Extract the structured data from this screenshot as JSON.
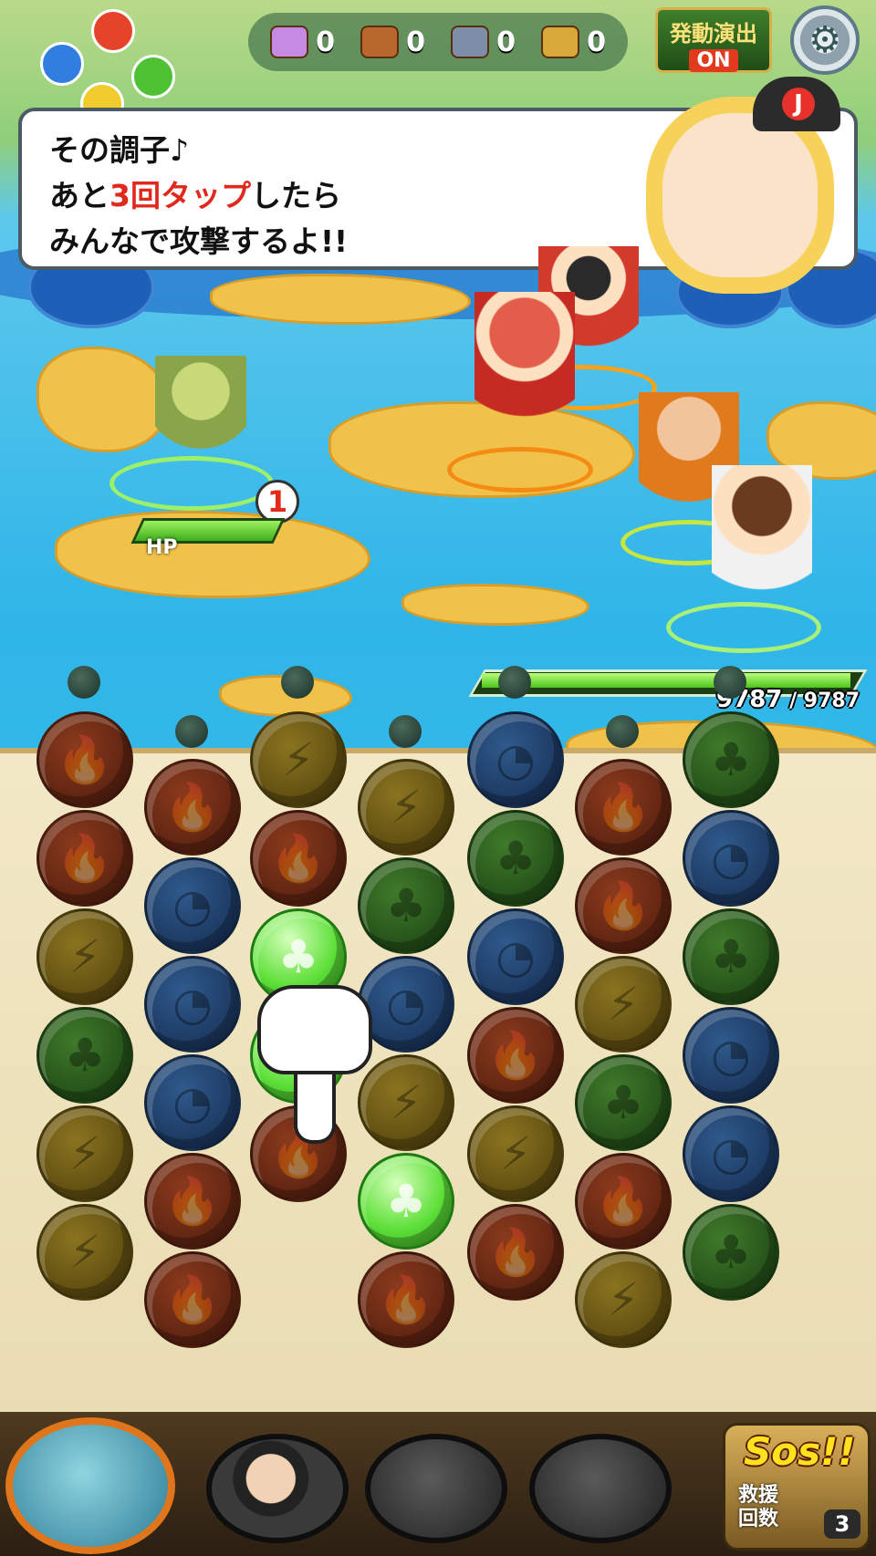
{
  "hud": {
    "chests": [
      {
        "icon": "rainbow-chest-icon",
        "count": "0",
        "color": "#c58be3"
      },
      {
        "icon": "bronze-chest-icon",
        "count": "0",
        "color": "#b8682d"
      },
      {
        "icon": "silver-chest-icon",
        "count": "0",
        "color": "#7f8ea8"
      },
      {
        "icon": "gold-chest-icon",
        "count": "0",
        "color": "#d9a83a"
      }
    ],
    "effect_button": {
      "line1": "発動演出",
      "line2": "ON"
    },
    "settings_icon": "gear-icon"
  },
  "dialog": {
    "line1": "その調子♪",
    "line2_pre": "あと",
    "line2_red": "3回タップ",
    "line2_post": "したら",
    "line3": "みんなで攻撃するよ!!"
  },
  "enemy": {
    "turn_count": "1",
    "hp_label": "HP",
    "hp_fraction": 1.0
  },
  "party_hp": {
    "current": "9787",
    "separator": " / ",
    "max": "9787",
    "fraction": 1.0
  },
  "board": {
    "cols": 7,
    "columns": [
      [
        "fire",
        "fire",
        "light",
        "wood",
        "light",
        "light"
      ],
      [
        "fire",
        "water",
        "water",
        "water",
        "fire",
        "fire"
      ],
      [
        "light",
        "fire",
        "wood-active",
        "wood-active",
        "fire",
        ""
      ],
      [
        "light",
        "wood",
        "water",
        "light",
        "wood-active",
        "fire"
      ],
      [
        "water",
        "wood",
        "water",
        "fire",
        "light",
        "fire"
      ],
      [
        "fire",
        "fire",
        "light",
        "wood",
        "fire",
        "light"
      ],
      [
        "wood",
        "water",
        "wood",
        "water",
        "water",
        "wood"
      ]
    ],
    "attribute_colors": {
      "fire": "#c2461d",
      "water": "#2e6bbd",
      "wood": "#3da03a",
      "light": "#d3b324"
    }
  },
  "bottom": {
    "sos_title": "Sos!!",
    "sos_label_1": "救援",
    "sos_label_2": "回数",
    "sos_count": "3"
  }
}
